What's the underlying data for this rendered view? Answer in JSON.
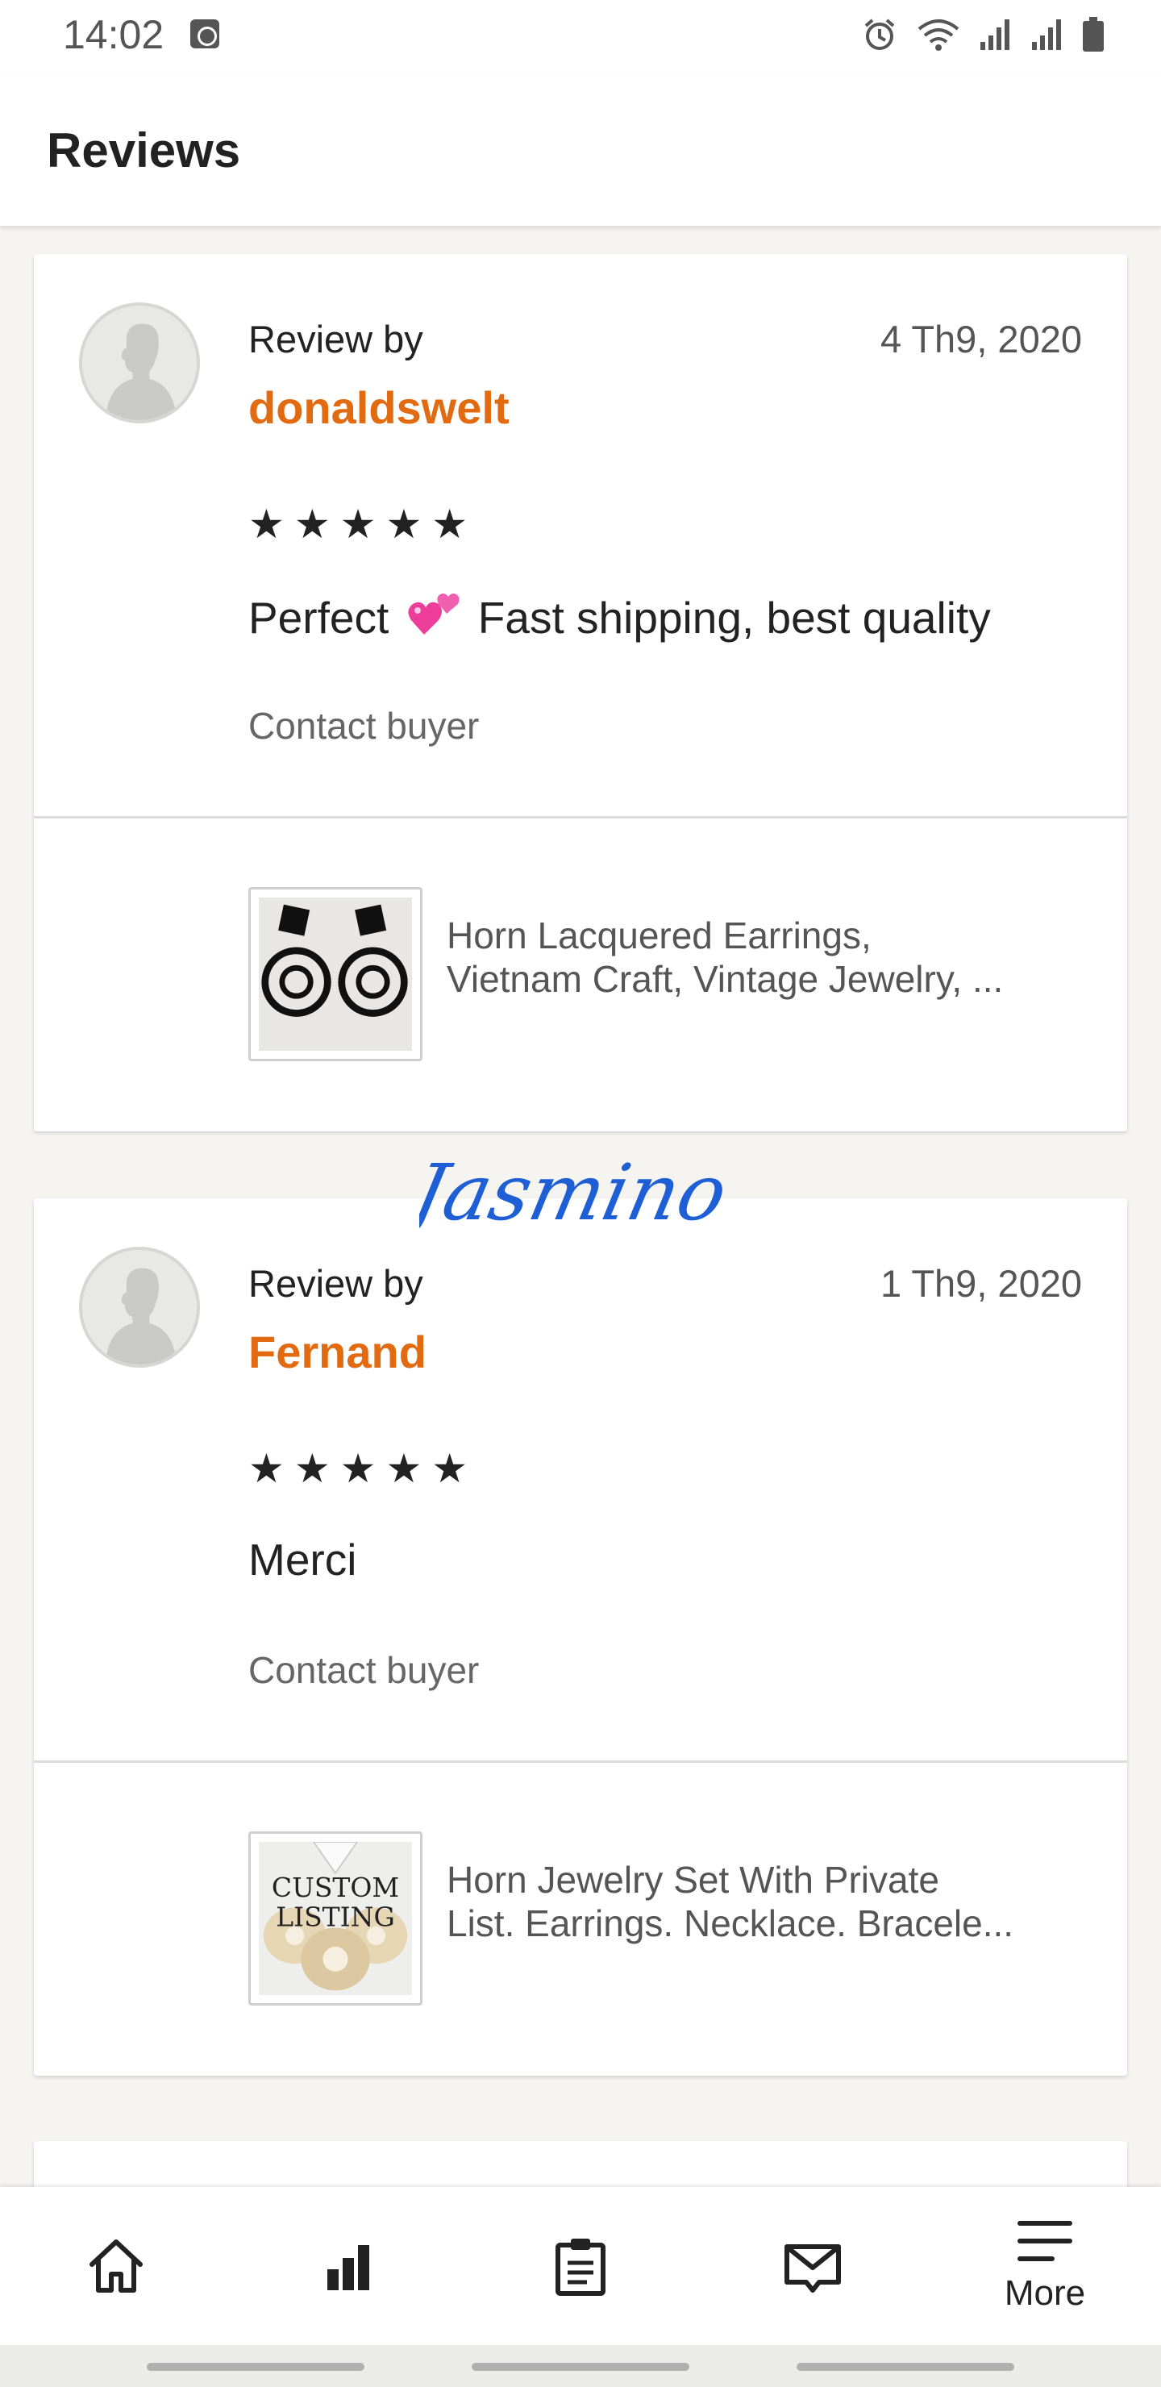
{
  "status_bar": {
    "time": "14:02"
  },
  "header": {
    "title": "Reviews"
  },
  "reviews": [
    {
      "review_by_label": "Review by",
      "reviewer": "donaldswelt",
      "date": "4 Th9, 2020",
      "rating": 5,
      "stars": "★★★★★",
      "text_before": "Perfect ",
      "text_after": " Fast shipping, best quality",
      "contact_label": "Contact buyer",
      "listing": {
        "title_line1": "Horn Lacquered Earrings,",
        "title_line2": "Vietnam Craft, Vintage Jewelry, ..."
      }
    },
    {
      "review_by_label": "Review by",
      "reviewer": "Fernand",
      "date": "1 Th9, 2020",
      "rating": 5,
      "stars": "★★★★★",
      "text": "Merci",
      "contact_label": "Contact buyer",
      "listing": {
        "title_line1": "Horn Jewelry Set With Private",
        "title_line2": "List. Earrings. Necklace. Bracele...",
        "thumb_text_line1": "CUSTOM",
        "thumb_text_line2": "LISTING"
      }
    }
  ],
  "watermark": {
    "signature": "Jasmino"
  },
  "bottom_nav": {
    "items": [
      {
        "icon": "home-icon"
      },
      {
        "icon": "stats-icon"
      },
      {
        "icon": "orders-icon"
      },
      {
        "icon": "messages-icon"
      },
      {
        "icon": "menu-icon",
        "label": "More"
      }
    ]
  },
  "colors": {
    "accent": "#e26a11",
    "background": "#f5f4f1",
    "signature": "#1f5fd6"
  }
}
